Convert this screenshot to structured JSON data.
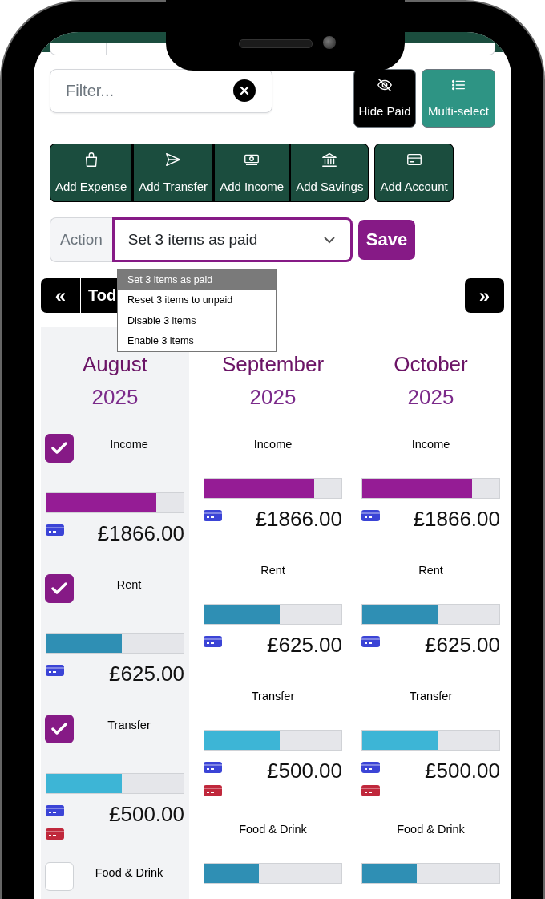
{
  "filter": {
    "placeholder": "Filter..."
  },
  "toggles": [
    {
      "label": "Hide Paid",
      "kind": "hide",
      "on": false
    },
    {
      "label": "Multi-select",
      "kind": "multi",
      "on": true
    }
  ],
  "add_button_groups": [
    {
      "buttons": [
        {
          "label": "Add Expense",
          "kind": "expense"
        },
        {
          "label": "Add Transfer",
          "kind": "transfer"
        },
        {
          "label": "Add Income",
          "kind": "income"
        },
        {
          "label": "Add Savings",
          "kind": "savings"
        }
      ]
    },
    {
      "buttons": [
        {
          "label": "Add Account",
          "kind": "account"
        }
      ]
    }
  ],
  "action": {
    "label": "Action",
    "value": "Set 3 items as paid",
    "expanded": true,
    "save": "Save",
    "options": [
      {
        "label": "Set 3 items as paid",
        "selected": true
      },
      {
        "label": "Reset 3 items to unpaid",
        "selected": false
      },
      {
        "label": "Disable 3 items",
        "selected": false
      },
      {
        "label": "Enable 3 items",
        "selected": false
      }
    ]
  },
  "nav": {
    "prev": "«",
    "today": "Tod",
    "next": "»"
  },
  "months": [
    {
      "month": "August",
      "year": "2025",
      "current": true,
      "selectable": true,
      "items": [
        {
          "name": "Income",
          "checked": true,
          "level": 0.8,
          "color": "#951c95",
          "cards": [
            {
              "color": "#3b44d6"
            }
          ],
          "amount": "£1866.00"
        },
        {
          "name": "Rent",
          "checked": true,
          "level": 0.55,
          "color": "#2f8fb4",
          "cards": [
            {
              "color": "#3b44d6"
            }
          ],
          "amount": "£625.00"
        },
        {
          "name": "Transfer",
          "checked": true,
          "level": 0.55,
          "color": "#3db5d6",
          "cards": [
            {
              "color": "#3b44d6"
            },
            {
              "color": "#c0283c"
            }
          ],
          "amount": "£500.00"
        },
        {
          "name": "Food & Drink",
          "checked": false
        }
      ]
    },
    {
      "month": "September",
      "year": "2025",
      "current": false,
      "selectable": false,
      "items": [
        {
          "name": "Income",
          "level": 0.8,
          "color": "#951c95",
          "cards": [
            {
              "color": "#3b44d6"
            }
          ],
          "amount": "£1866.00"
        },
        {
          "name": "Rent",
          "level": 0.55,
          "color": "#2f8fb4",
          "cards": [
            {
              "color": "#3b44d6"
            }
          ],
          "amount": "£625.00"
        },
        {
          "name": "Transfer",
          "level": 0.55,
          "color": "#3db5d6",
          "cards": [
            {
              "color": "#3b44d6"
            },
            {
              "color": "#c0283c"
            }
          ],
          "amount": "£500.00"
        },
        {
          "name": "Food & Drink",
          "level": 0.4,
          "color": "#2f8fb4"
        }
      ]
    },
    {
      "month": "October",
      "year": "2025",
      "current": false,
      "selectable": false,
      "items": [
        {
          "name": "Income",
          "level": 0.8,
          "color": "#951c95",
          "cards": [
            {
              "color": "#3b44d6"
            }
          ],
          "amount": "£1866.00"
        },
        {
          "name": "Rent",
          "level": 0.55,
          "color": "#2f8fb4",
          "cards": [
            {
              "color": "#3b44d6"
            }
          ],
          "amount": "£625.00"
        },
        {
          "name": "Transfer",
          "level": 0.55,
          "color": "#3db5d6",
          "cards": [
            {
              "color": "#3b44d6"
            },
            {
              "color": "#c0283c"
            }
          ],
          "amount": "£500.00"
        },
        {
          "name": "Food & Drink",
          "level": 0.4,
          "color": "#2f8fb4"
        }
      ]
    }
  ]
}
